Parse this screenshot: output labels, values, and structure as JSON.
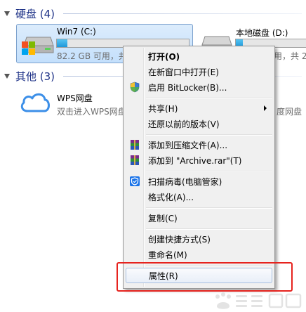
{
  "sections": {
    "hard_disks": {
      "title": "硬盘 (4)"
    },
    "other": {
      "title": "其他 (3)"
    }
  },
  "drives": {
    "c": {
      "name": "Win7 (C:)",
      "info": "82.2 GB 可用，共",
      "fill_fraction": 0.08
    },
    "d": {
      "name": "本地磁盘 (D:)",
      "info": "可用，共 2",
      "fill_fraction": 0.1
    }
  },
  "wps": {
    "name": "WPS网盘",
    "description": "双击进入WPS网盘",
    "right_text": "度网盘"
  },
  "context_menu": {
    "items": [
      {
        "label": "打开(O)"
      },
      {
        "label": "在新窗口中打开(E)"
      },
      {
        "label": "启用 BitLocker(B)..."
      },
      {
        "label": "共享(H)"
      },
      {
        "label": "还原以前的版本(V)"
      },
      {
        "label": "添加到压缩文件(A)..."
      },
      {
        "label": "添加到 \"Archive.rar\"(T)"
      },
      {
        "label": "扫描病毒(电脑管家)"
      },
      {
        "label": "格式化(A)..."
      },
      {
        "label": "复制(C)"
      },
      {
        "label": "创建快捷方式(S)"
      },
      {
        "label": "重命名(M)"
      },
      {
        "label": "属性(R)"
      }
    ]
  },
  "colors": {
    "section_title": "#1e3287",
    "highlight_box": "#e6231e",
    "wps_cloud": "#3c8fe8"
  }
}
